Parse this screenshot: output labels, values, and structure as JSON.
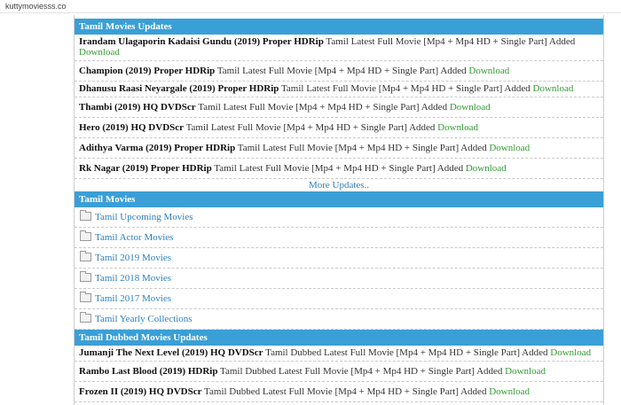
{
  "browser": {
    "url": "kuttymoviesss.co"
  },
  "sections": {
    "updates": {
      "title": "Tamil Movies Updates",
      "rows": [
        {
          "title": "Irandam Ulagaporin Kadaisi Gundu (2019) Proper HDRip",
          "rest": " Tamil Latest Full Movie [Mp4 + Mp4 HD + Single Part] Added ",
          "dl": "Download"
        },
        {
          "title": "Champion (2019) Proper HDRip",
          "rest": " Tamil Latest Full Movie [Mp4 + Mp4 HD + Single Part] Added ",
          "dl": "Download"
        },
        {
          "title": "Dhanusu Raasi Neyargale (2019) Proper HDRip",
          "rest": " Tamil Latest Full Movie [Mp4 + Mp4 HD + Single Part] Added ",
          "dl": "Download"
        },
        {
          "title": "Thambi (2019) HQ DVDScr",
          "rest": " Tamil Latest Full Movie [Mp4 + Mp4 HD + Single Part] Added ",
          "dl": "Download"
        },
        {
          "title": "Hero (2019) HQ DVDScr",
          "rest": " Tamil Latest Full Movie [Mp4 + Mp4 HD + Single Part] Added ",
          "dl": "Download"
        },
        {
          "title": "Adithya Varma (2019) Proper HDRip",
          "rest": " Tamil Latest Full Movie [Mp4 + Mp4 HD + Single Part] Added ",
          "dl": "Download"
        },
        {
          "title": "Rk Nagar (2019) Proper HDRip",
          "rest": " Tamil Latest Full Movie [Mp4 + Mp4 HD + Single Part] Added ",
          "dl": "Download"
        }
      ],
      "more": "More Updates.."
    },
    "movies": {
      "title": "Tamil Movies",
      "items": [
        "Tamil Upcoming Movies",
        "Tamil Actor Movies",
        "Tamil 2019 Movies",
        "Tamil 2018 Movies",
        "Tamil 2017 Movies",
        "Tamil Yearly Collections"
      ]
    },
    "dubbed": {
      "title": "Tamil Dubbed Movies Updates",
      "rows": [
        {
          "title": "Jumanji The Next Level (2019) HQ DVDScr",
          "rest": " Tamil Dubbed Latest Full Movie [Mp4 + Mp4 HD + Single Part] Added ",
          "dl": "Download"
        },
        {
          "title": "Rambo Last Blood (2019) HDRip",
          "rest": " Tamil Dubbed Latest Full Movie [Mp4 + Mp4 HD + Single Part] Added ",
          "dl": "Download"
        },
        {
          "title": "Frozen II (2019) HQ DVDScr",
          "rest": " Tamil Dubbed Latest Full Movie [Mp4 + Mp4 HD + Single Part] Added ",
          "dl": "Download"
        }
      ]
    }
  }
}
